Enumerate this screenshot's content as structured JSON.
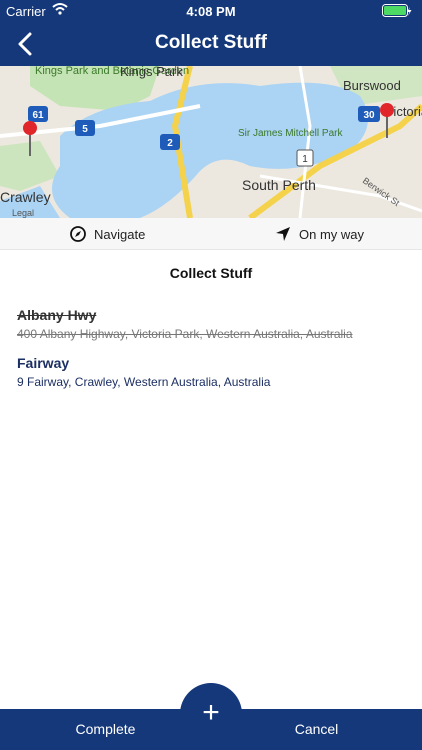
{
  "status_bar": {
    "carrier": "Carrier",
    "time": "4:08 PM"
  },
  "header": {
    "title": "Collect Stuff",
    "back_icon": "chevron-left-icon"
  },
  "map": {
    "labels": {
      "kings_park_garden": "Kings Park and Botanic Garden",
      "kings_park": "Kings Park",
      "burswood": "Burswood",
      "victoria_park": "Victoria Park",
      "crawley": "Crawley",
      "sir_james": "Sir James Mitchell Park",
      "south_perth": "South Perth",
      "berwick": "Berwick St",
      "legal": "Legal"
    },
    "shields": [
      "61",
      "5",
      "2",
      "1",
      "30"
    ],
    "colors": {
      "water": "#aad3f4",
      "park": "#c5e4b5",
      "land": "#ece8df",
      "highway": "#f5d24c",
      "pin": "#e0262b"
    }
  },
  "actions": {
    "navigate": "Navigate",
    "on_my_way": "On my way"
  },
  "list": {
    "title": "Collect Stuff",
    "items": [
      {
        "name": "Albany Hwy",
        "address": "400 Albany Highway, Victoria Park, Western Australia, Australia",
        "completed": true
      },
      {
        "name": "Fairway",
        "address": "9 Fairway, Crawley, Western Australia, Australia",
        "completed": false
      }
    ]
  },
  "footer": {
    "complete": "Complete",
    "cancel": "Cancel",
    "add": "+"
  },
  "colors": {
    "primary": "#14387a"
  }
}
